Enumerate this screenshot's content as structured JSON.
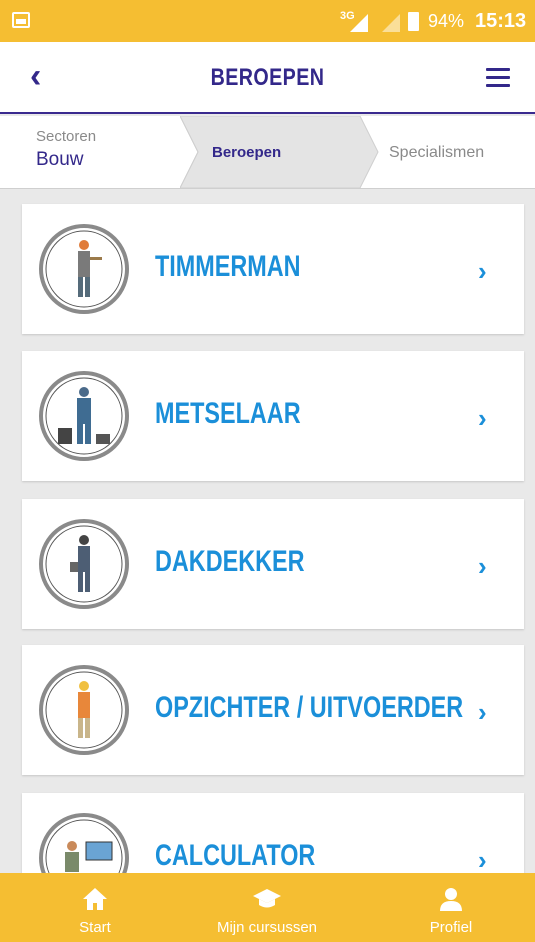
{
  "status_bar": {
    "network": "3G",
    "battery_pct": "94%",
    "time": "15:13"
  },
  "header": {
    "back_icon": "chevron-left-icon",
    "title": "BEROEPEN",
    "menu_icon": "hamburger-icon"
  },
  "breadcrumb": {
    "sector_caption": "Sectoren",
    "sector_value": "Bouw",
    "current": "Beroepen",
    "next": "Specialismen"
  },
  "professions": [
    {
      "label": "TIMMERMAN",
      "icon": "carpenter-avatar",
      "chevron": "›"
    },
    {
      "label": "METSELAAR",
      "icon": "bricklayer-avatar",
      "chevron": "›"
    },
    {
      "label": "DAKDEKKER",
      "icon": "roofer-avatar",
      "chevron": "›"
    },
    {
      "label": "OPZICHTER / UITVOERDER",
      "icon": "supervisor-avatar",
      "chevron": "›"
    },
    {
      "label": "CALCULATOR",
      "icon": "calculator-avatar",
      "chevron": "›"
    }
  ],
  "tabbar": [
    {
      "label": "Start",
      "icon": "home-icon"
    },
    {
      "label": "Mijn cursussen",
      "icon": "graduation-cap-icon"
    },
    {
      "label": "Profiel",
      "icon": "person-icon"
    }
  ],
  "colors": {
    "accent": "#f5be32",
    "brand": "#33288a",
    "link": "#1b8fd9"
  }
}
